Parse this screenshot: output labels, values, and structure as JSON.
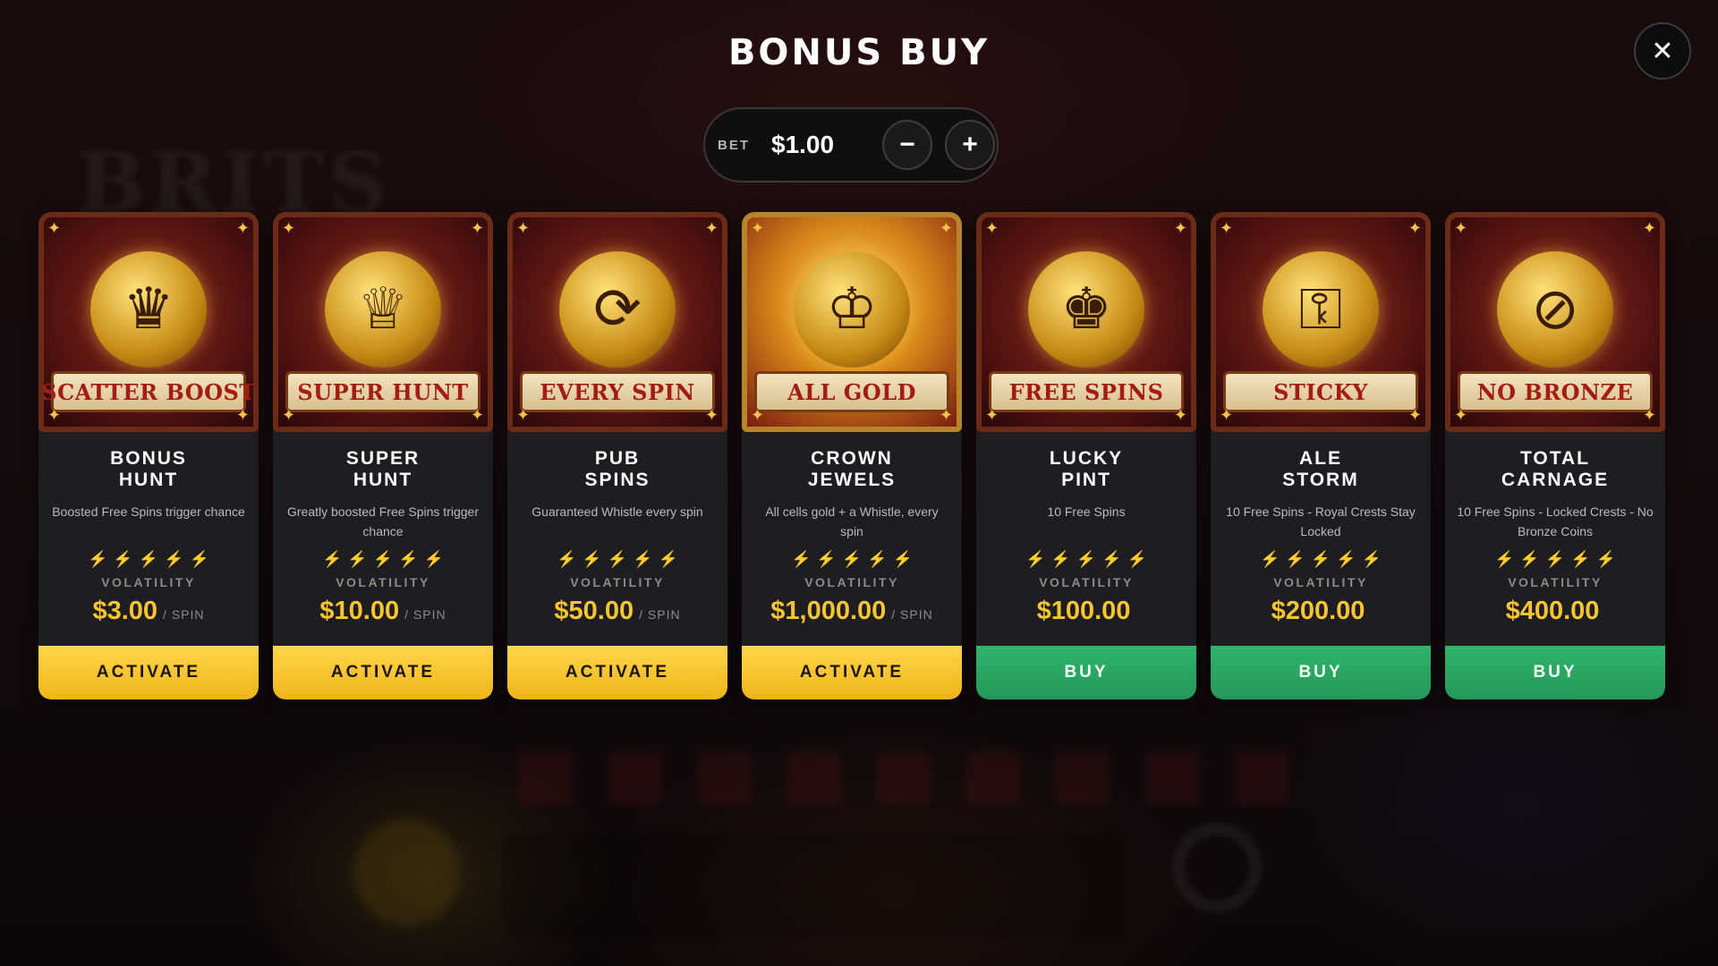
{
  "title": "BONUS BUY",
  "close_icon": "✕",
  "background": {
    "logo_text": "BRITS"
  },
  "bet": {
    "label": "BET",
    "value": "$1.00",
    "minus": "−",
    "plus": "+"
  },
  "volatility_label": "VOLATILITY",
  "cards": [
    {
      "banner": "SCATTER BOOST",
      "name": "BONUS\nHUNT",
      "description": "Boosted Free Spins trigger chance",
      "volatility": 5,
      "price": "$3.00",
      "per": "/ SPIN",
      "action": "ACTIVATE",
      "action_type": "activate",
      "icon": "scatter-boost-icon",
      "glyph": "♛"
    },
    {
      "banner": "SUPER HUNT",
      "name": "SUPER\nHUNT",
      "description": "Greatly boosted Free Spins trigger chance",
      "volatility": 5,
      "price": "$10.00",
      "per": "/ SPIN",
      "action": "ACTIVATE",
      "action_type": "activate",
      "icon": "super-hunt-icon",
      "glyph": "♕"
    },
    {
      "banner": "EVERY SPIN",
      "name": "PUB\nSPINS",
      "description": "Guaranteed Whistle every spin",
      "volatility": 4,
      "price": "$50.00",
      "per": "/ SPIN",
      "action": "ACTIVATE",
      "action_type": "activate",
      "icon": "whistle-icon",
      "glyph": "⟳"
    },
    {
      "banner": "ALL GOLD",
      "name": "CROWN\nJEWELS",
      "description": "All cells gold + a Whistle, every spin",
      "volatility": 1,
      "price": "$1,000.00",
      "per": "/ SPIN",
      "action": "ACTIVATE",
      "action_type": "activate",
      "icon": "crown-icon",
      "glyph": "♔",
      "gold": true
    },
    {
      "banner": "FREE SPINS",
      "name": "LUCKY\nPINT",
      "description": "10 Free Spins",
      "volatility": 3,
      "price": "$100.00",
      "per": "",
      "action": "BUY",
      "action_type": "buy",
      "icon": "free-spins-icon",
      "glyph": "♚"
    },
    {
      "banner": "STICKY",
      "name": "ALE\nSTORM",
      "description": "10 Free Spins - Royal Crests Stay Locked",
      "volatility": 3,
      "price": "$200.00",
      "per": "",
      "action": "BUY",
      "action_type": "buy",
      "icon": "padlock-icon",
      "glyph": "⚿"
    },
    {
      "banner": "NO BRONZE",
      "name": "TOTAL\nCARNAGE",
      "description": "10 Free Spins - Locked Crests - No Bronze Coins",
      "volatility": 2,
      "price": "$400.00",
      "per": "",
      "action": "BUY",
      "action_type": "buy",
      "icon": "no-bronze-icon",
      "glyph": "⊘"
    }
  ]
}
